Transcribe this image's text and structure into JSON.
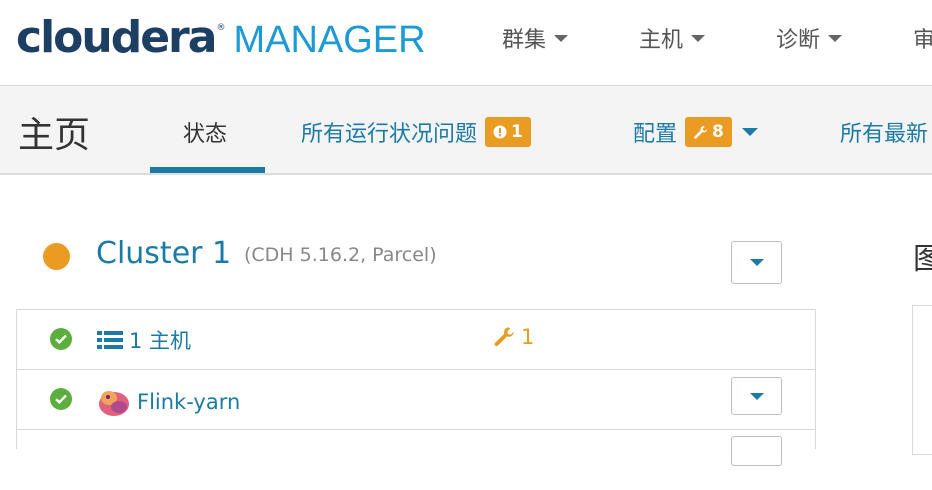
{
  "brand": {
    "logo_main": "cloudera",
    "logo_reg": "®",
    "logo_product": "MANAGER"
  },
  "topnav": {
    "items": [
      {
        "label": "群集"
      },
      {
        "label": "主机"
      },
      {
        "label": "诊断"
      },
      {
        "label": "审"
      }
    ]
  },
  "subnav": {
    "page_title": "主页",
    "tabs": [
      {
        "label": "状态",
        "active": true
      },
      {
        "label": "所有运行状况问题",
        "badge": "1",
        "badge_icon": "exclamation-circle-icon"
      },
      {
        "label": "配置",
        "badge": "8",
        "badge_icon": "wrench-icon"
      },
      {
        "label": "所有最新"
      }
    ]
  },
  "cluster": {
    "name": "Cluster 1",
    "version": "(CDH 5.16.2, Parcel)",
    "status_color": "#e99b22"
  },
  "right": {
    "heading_char": "图"
  },
  "rows": [
    {
      "status_icon": "check-circle-icon",
      "icon": "list-icon",
      "label": "1 主机",
      "config_count": "1"
    },
    {
      "status_icon": "check-circle-icon",
      "icon": "flink-icon",
      "label": "Flink-yarn"
    }
  ],
  "colors": {
    "accent": "#1c7aa6",
    "brand_dark": "#1d3f63",
    "brand_light": "#1c9ad6",
    "warning": "#e99b22",
    "ok": "#5cae3e"
  }
}
